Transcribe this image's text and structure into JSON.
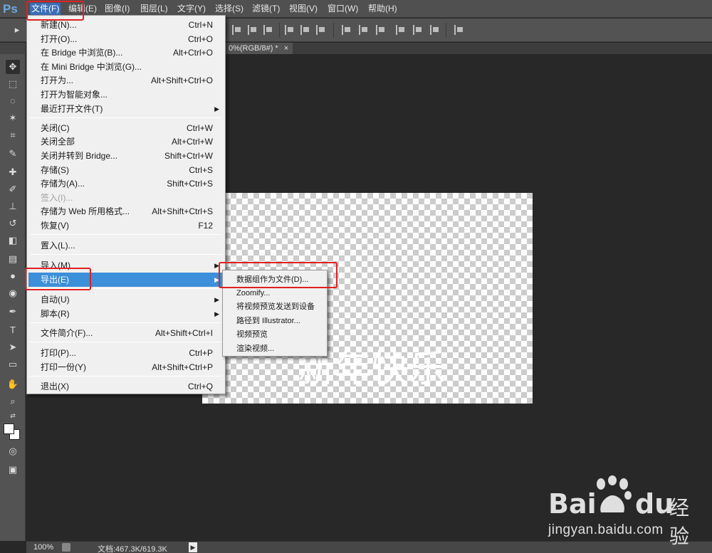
{
  "app": {
    "logo": "Ps"
  },
  "menubar": {
    "items": [
      "文件(F)",
      "编辑(E)",
      "图像(I)",
      "图层(L)",
      "文字(Y)",
      "选择(S)",
      "滤镜(T)",
      "视图(V)",
      "窗口(W)",
      "帮助(H)"
    ]
  },
  "tab": {
    "title": "0%(RGB/8#) *",
    "close": "×"
  },
  "canvas": {
    "text": "新年快乐"
  },
  "status": {
    "zoom": "100%",
    "doc_size": "文档:467.3K/619.3K",
    "arrow": "▶"
  },
  "file_menu": {
    "items": [
      {
        "label": "新建(N)...",
        "shortcut": "Ctrl+N"
      },
      {
        "label": "打开(O)...",
        "shortcut": "Ctrl+O"
      },
      {
        "label": "在 Bridge 中浏览(B)...",
        "shortcut": "Alt+Ctrl+O"
      },
      {
        "label": "在 Mini Bridge 中浏览(G)...",
        "shortcut": ""
      },
      {
        "label": "打开为...",
        "shortcut": "Alt+Shift+Ctrl+O"
      },
      {
        "label": "打开为智能对象...",
        "shortcut": ""
      },
      {
        "label": "最近打开文件(T)",
        "shortcut": ""
      },
      {
        "label": "关闭(C)",
        "shortcut": "Ctrl+W"
      },
      {
        "label": "关闭全部",
        "shortcut": "Alt+Ctrl+W"
      },
      {
        "label": "关闭并转到 Bridge...",
        "shortcut": "Shift+Ctrl+W"
      },
      {
        "label": "存储(S)",
        "shortcut": "Ctrl+S"
      },
      {
        "label": "存储为(A)...",
        "shortcut": "Shift+Ctrl+S"
      },
      {
        "label": "签入(I)...",
        "shortcut": ""
      },
      {
        "label": "存储为 Web 所用格式...",
        "shortcut": "Alt+Shift+Ctrl+S"
      },
      {
        "label": "恢复(V)",
        "shortcut": "F12"
      },
      {
        "label": "置入(L)...",
        "shortcut": ""
      },
      {
        "label": "导入(M)",
        "shortcut": ""
      },
      {
        "label": "导出(E)",
        "shortcut": ""
      },
      {
        "label": "自动(U)",
        "shortcut": ""
      },
      {
        "label": "脚本(R)",
        "shortcut": ""
      },
      {
        "label": "文件简介(F)...",
        "shortcut": "Alt+Shift+Ctrl+I"
      },
      {
        "label": "打印(P)...",
        "shortcut": "Ctrl+P"
      },
      {
        "label": "打印一份(Y)",
        "shortcut": "Alt+Shift+Ctrl+P"
      },
      {
        "label": "退出(X)",
        "shortcut": "Ctrl+Q"
      }
    ],
    "submenu_arrow": "▶"
  },
  "export_submenu": {
    "items": [
      "数据组作为文件(D)...",
      "Zoomify...",
      "将视频预览发送到设备",
      "路径到 Illustrator...",
      "视频预览",
      "渲染视频..."
    ]
  },
  "watermark": {
    "bai": "Bai",
    "du": "du",
    "jingyan": "经验",
    "url": "jingyan.baidu.com"
  },
  "colors": {
    "menu_highlight": "#3c8fd9",
    "annotation": "#e02020",
    "menubar": "#505050",
    "workspace": "#282828"
  }
}
